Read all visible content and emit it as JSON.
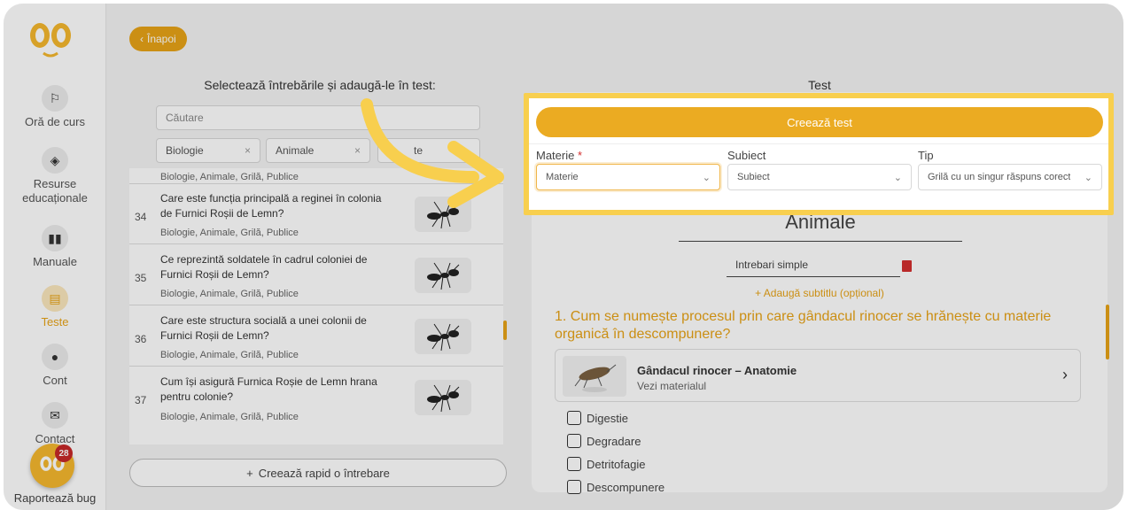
{
  "sidebar": {
    "items": [
      {
        "label": "Oră de curs",
        "icon": "lesson-icon"
      },
      {
        "label": "Resurse educaționale",
        "icon": "cube-icon"
      },
      {
        "label": "Manuale",
        "icon": "book-icon"
      },
      {
        "label": "Teste",
        "icon": "document-icon"
      },
      {
        "label": "Cont",
        "icon": "user-icon"
      },
      {
        "label": "Contact",
        "icon": "mail-icon"
      }
    ],
    "bug_label": "Raportează bug",
    "bug_badge": "28"
  },
  "back_label": "Înapoi",
  "left": {
    "title": "Selectează întrebările și adaugă-le în test:",
    "search_placeholder": "Căutare",
    "filters": [
      "Biologie",
      "Animale",
      "te"
    ],
    "top_meta": "Biologie, Animale, Grilă, Publice",
    "questions": [
      {
        "num": "34",
        "text": "Care este funcția principală a reginei în colonia de Furnici Roșii de Lemn?",
        "meta": "Biologie, Animale, Grilă, Publice"
      },
      {
        "num": "35",
        "text": "Ce reprezintă soldatele în cadrul coloniei de Furnici Roșii de Lemn?",
        "meta": "Biologie, Animale, Grilă, Publice"
      },
      {
        "num": "36",
        "text": "Care este structura socială a unei colonii de Furnici Roșii de Lemn?",
        "meta": "Biologie, Animale, Grilă, Publice"
      },
      {
        "num": "37",
        "text": "Cum își asigură Furnica Roșie de Lemn hrana pentru colonie?",
        "meta": "Biologie, Animale, Grilă, Publice"
      }
    ],
    "quick_create": "Creează rapid o întrebare"
  },
  "right": {
    "title": "Test",
    "test_name": "Animale",
    "subtitle_value": "Intrebari simple",
    "add_subtitle": "+ Adaugă subtitlu (opțional)",
    "question": "1. Cum se numește procesul prin care gândacul rinocer se hrănește cu materie organică în descompunere?",
    "material": {
      "title": "Gândacul rinocer – Anatomie",
      "subtitle": "Vezi materialul"
    },
    "options": [
      "Digestie",
      "Degradare",
      "Detritofagie",
      "Descompunere"
    ]
  },
  "popup": {
    "create_label": "Creează test",
    "materie_label": "Materie",
    "materie_required": "*",
    "materie_placeholder": "Materie",
    "subiect_label": "Subiect",
    "subiect_placeholder": "Subiect",
    "tip_label": "Tip",
    "tip_value": "Grilă cu un singur răspuns corect"
  },
  "colors": {
    "accent": "#e8a317",
    "highlight": "#f8cf4e",
    "danger": "#d32f2f"
  }
}
